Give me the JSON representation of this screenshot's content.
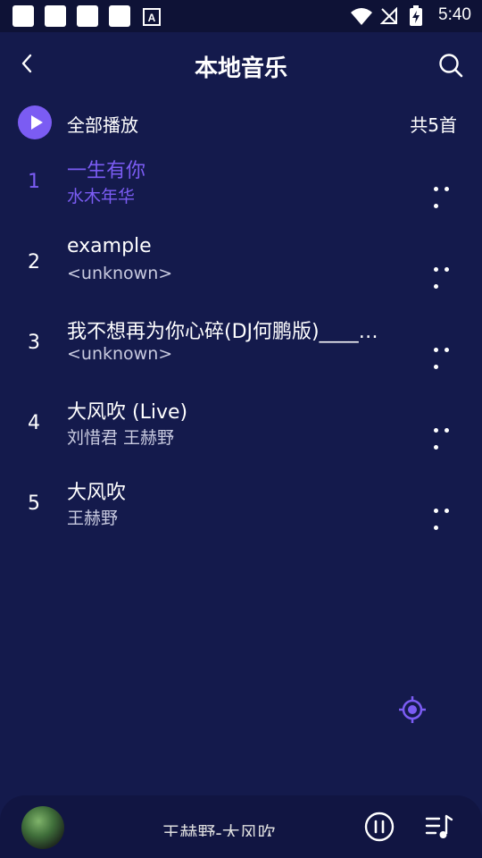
{
  "status_bar": {
    "time": "5:40"
  },
  "header": {
    "title": "本地音乐"
  },
  "play_all": {
    "label": "全部播放",
    "count": "共5首"
  },
  "songs": [
    {
      "index": "1",
      "title": " 一生有你",
      "artist": "水木年华",
      "active": true
    },
    {
      "index": "2",
      "title": "example",
      "artist": "<unknown>",
      "active": false
    },
    {
      "index": "3",
      "title": "我不想再为你心碎(DJ何鹏版)____…",
      "artist": "<unknown>",
      "active": false
    },
    {
      "index": "4",
      "title": "大风吹 (Live)",
      "artist": "刘惜君  王赫野",
      "active": false
    },
    {
      "index": "5",
      "title": "大风吹",
      "artist": "王赫野",
      "active": false
    }
  ],
  "player": {
    "now_playing": "王赫野-大风吹"
  },
  "colors": {
    "accent": "#7b5cf3",
    "background": "#141a4c"
  }
}
